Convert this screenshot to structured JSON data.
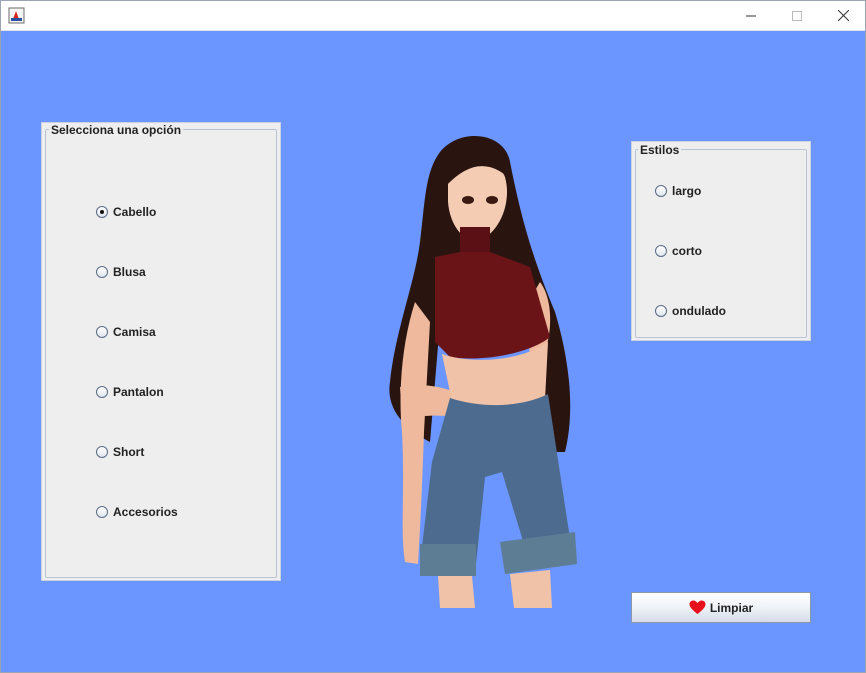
{
  "left_panel": {
    "title": "Selecciona una opción",
    "options": [
      {
        "label": "Cabello",
        "selected": true
      },
      {
        "label": "Blusa",
        "selected": false
      },
      {
        "label": "Camisa",
        "selected": false
      },
      {
        "label": "Pantalon",
        "selected": false
      },
      {
        "label": "Short",
        "selected": false
      },
      {
        "label": "Accesorios",
        "selected": false
      }
    ]
  },
  "styles_panel": {
    "title": "Estilos",
    "options": [
      {
        "label": "largo",
        "selected": false
      },
      {
        "label": "corto",
        "selected": false
      },
      {
        "label": "ondulado",
        "selected": false
      }
    ]
  },
  "button": {
    "label": "Limpiar",
    "icon": "heart-icon"
  },
  "colors": {
    "background": "#6b95ff",
    "panel": "#eeeeee",
    "heart": "#e8101c"
  }
}
